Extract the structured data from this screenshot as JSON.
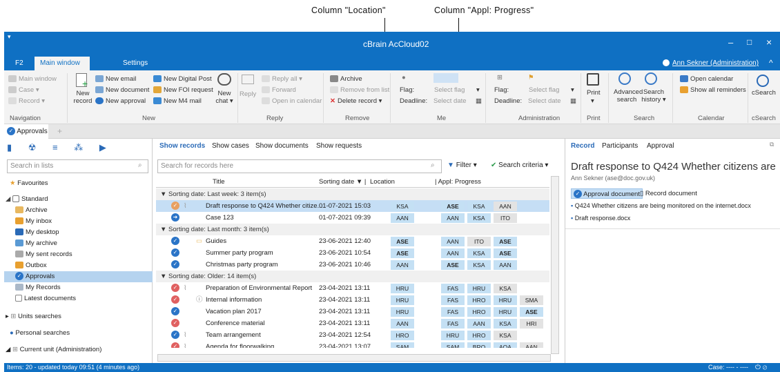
{
  "annotations": {
    "location": "Column \"Location\"",
    "progress": "Column \"Appl: Progress\""
  },
  "window": {
    "title": "cBrain AcCloud02",
    "user": "Ann Sekner (Administration)",
    "minimize": "–",
    "maximize": "□",
    "close": "×"
  },
  "tabs": {
    "f2": "F2",
    "main": "Main window",
    "settings": "Settings"
  },
  "ribbon": {
    "nav": {
      "main_window": "Main window",
      "case": "Case ▾",
      "record": "Record ▾",
      "group": "Navigation"
    },
    "new": {
      "record_line1": "New",
      "record_line2": "record",
      "email": "New email",
      "document": "New document",
      "approval": "New approval",
      "digital_post": "New Digital Post",
      "foi": "New FOI request",
      "m4": "New M4 mail",
      "chat_line1": "New",
      "chat_line2": "chat ▾",
      "group": "New"
    },
    "reply": {
      "reply_all": "Reply all ▾",
      "forward": "Forward",
      "reply": "Reply",
      "open_calendar": "Open in calendar",
      "group": "Reply"
    },
    "remove": {
      "archive": "Archive",
      "remove_list": "Remove from list",
      "delete": "Delete record ▾",
      "group": "Remove"
    },
    "me": {
      "flag": "Flag:",
      "select_flag": "Select flag",
      "deadline": "Deadline:",
      "select_date": "Select date",
      "group": "Me"
    },
    "admin": {
      "flag": "Flag:",
      "select_flag": "Select flag",
      "deadline": "Deadline:",
      "select_date": "Select date",
      "group": "Administration"
    },
    "print": {
      "label": "Print",
      "sub": "▾",
      "group": "Print"
    },
    "search": {
      "advanced_line1": "Advanced",
      "advanced_line2": "search",
      "history_line1": "Search",
      "history_line2": "history ▾",
      "group": "Search"
    },
    "calendar": {
      "open": "Open calendar",
      "reminders": "Show all reminders",
      "group": "Calendar"
    },
    "csearch": {
      "label": "cSearch",
      "group": "cSearch"
    }
  },
  "doc_tab": {
    "label": "Approvals",
    "add": "+"
  },
  "left": {
    "search_placeholder": "Search in lists",
    "favourites": "Favourites",
    "standard": "Standard",
    "items": [
      "Archive",
      "My inbox",
      "My desktop",
      "My archive",
      "My sent records",
      "Outbox",
      "Approvals",
      "My Records",
      "Latest documents"
    ],
    "units": "Units searches",
    "personal": "Personal searches",
    "current_unit": "Current unit (Administration)"
  },
  "mid": {
    "tabs": [
      "Show records",
      "Show cases",
      "Show documents",
      "Show requests"
    ],
    "search_placeholder": "Search for records here",
    "filter": "Filter ▾",
    "criteria": "Search criteria ▾",
    "headers": {
      "title": "Title",
      "sorting": "Sorting date",
      "location": "Location",
      "progress": "Appl: Progress"
    },
    "groups": [
      "Sorting date: Last week: 3 item(s)",
      "Sorting date: Last month: 3 item(s)",
      "Sorting date: Older: 14 item(s)"
    ],
    "rows": [
      {
        "title": "Draft response to Q424 Whether citize...",
        "date": "01-07-2021 15:03",
        "loc": "KSA",
        "prog": [
          "ASE",
          "KSA",
          "AAN"
        ]
      },
      {
        "title": "Case 123",
        "date": "01-07-2021 09:39",
        "loc": "AAN",
        "prog": [
          "AAN",
          "KSA",
          "ITO"
        ]
      },
      {
        "title": "Guides",
        "date": "23-06-2021 12:40",
        "loc": "ASE",
        "prog": [
          "AAN",
          "ITO",
          "ASE"
        ]
      },
      {
        "title": "Summer party program",
        "date": "23-06-2021 10:54",
        "loc": "ASE",
        "prog": [
          "AAN",
          "KSA",
          "ASE"
        ]
      },
      {
        "title": "Christmas party program",
        "date": "23-06-2021 10:46",
        "loc": "AAN",
        "prog": [
          "ASE",
          "KSA",
          "AAN"
        ]
      },
      {
        "title": "Preparation of Environmental Report",
        "date": "23-04-2021 13:11",
        "loc": "HRU",
        "prog": [
          "FAS",
          "HRU",
          "KSA"
        ]
      },
      {
        "title": "Internal information",
        "date": "23-04-2021 13:11",
        "loc": "HRU",
        "prog": [
          "FAS",
          "HRO",
          "HRU",
          "SMA"
        ]
      },
      {
        "title": "Vacation plan 2017",
        "date": "23-04-2021 13:11",
        "loc": "HRU",
        "prog": [
          "FAS",
          "HRO",
          "HRU",
          "ASE"
        ]
      },
      {
        "title": "Conference material",
        "date": "23-04-2021 13:11",
        "loc": "AAN",
        "prog": [
          "FAS",
          "AAN",
          "KSA",
          "HRI"
        ]
      },
      {
        "title": "Team arrangement",
        "date": "23-04-2021 12:54",
        "loc": "HRO",
        "prog": [
          "HRU",
          "HRO",
          "KSA"
        ]
      },
      {
        "title": "Agenda for floorwalking",
        "date": "23-04-2021 13:07",
        "loc": "SAM",
        "prog": [
          "SAM",
          "BRO",
          "AQA",
          "AAN"
        ]
      }
    ]
  },
  "right": {
    "tabs": [
      "Record",
      "Participants",
      "Approval"
    ],
    "title": "Draft response to Q424 Whether citizens are be...",
    "email": "Ann Sekner (ase@doc.gov.uk)",
    "approval_doc": "Approval document",
    "record_doc": "Record document",
    "files": [
      "Q424 Whether citizens are being monitored on the internet.docx",
      "Draft response.docx"
    ]
  },
  "status": {
    "left": "Items: 20 - updated today 09:51 (4 minutes ago)",
    "right": "Case: ---- - ----"
  }
}
